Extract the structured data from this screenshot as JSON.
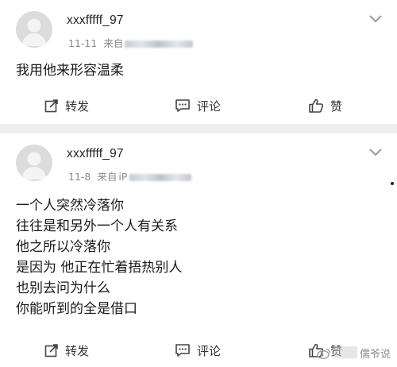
{
  "posts": [
    {
      "username": "xxxfffff_97",
      "date": "11-11",
      "source_prefix": "来自",
      "content_lines": [
        "我用他来形容温柔"
      ],
      "actions": {
        "repost": "转发",
        "comment": "评论",
        "like": "赞"
      }
    },
    {
      "username": "xxxfffff_97",
      "date": "11-8",
      "source_prefix": "来自",
      "source_partial": "iP",
      "content_lines": [
        "一个人突然冷落你",
        "往往是和另外一个人有关系",
        "他之所以冷落你",
        "是因为 他正在忙着捂热别人",
        "也别去问为什么",
        "你能听到的全是借口"
      ],
      "actions": {
        "repost": "转发",
        "comment": "评论",
        "like": "赞"
      }
    }
  ],
  "watermark": {
    "text": "儒爷说"
  },
  "colors": {
    "separator": "#efefef",
    "meta": "#8a8a8a",
    "text": "#1a1a1a"
  },
  "icons": [
    "avatar-placeholder",
    "chevron-down-icon",
    "repost-icon",
    "comment-icon",
    "thumbs-up-icon",
    "weibo-logo-icon"
  ]
}
